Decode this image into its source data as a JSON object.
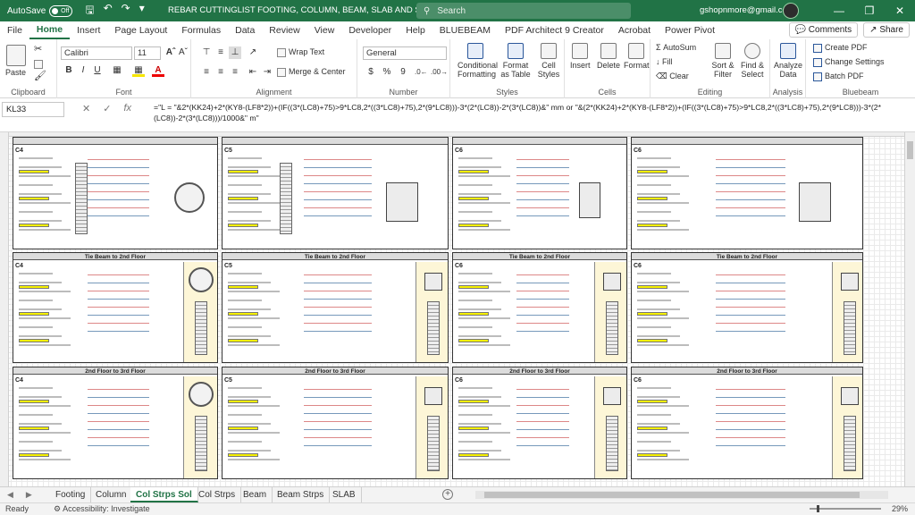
{
  "titlebar": {
    "autosave_label": "AutoSave",
    "autosave_state": "Off",
    "doc_title": "REBAR CUTTINGLIST FOOTING, COLUMN, BEAM, SLAB AND STIRRUPS",
    "search_placeholder": "Search",
    "user_email": "gshopnmore@gmail.com"
  },
  "menu": {
    "tabs": [
      "File",
      "Home",
      "Insert",
      "Page Layout",
      "Formulas",
      "Data",
      "Review",
      "View",
      "Developer",
      "Help",
      "BLUEBEAM",
      "PDF Architect 9 Creator",
      "Acrobat",
      "Power Pivot"
    ],
    "comments": "Comments",
    "share": "Share"
  },
  "ribbon": {
    "clipboard": {
      "label": "Clipboard",
      "paste": "Paste"
    },
    "font": {
      "label": "Font",
      "name": "Calibri",
      "size": "11",
      "bold": "B",
      "italic": "I",
      "underline": "U"
    },
    "alignment": {
      "label": "Alignment",
      "wrap": "Wrap Text",
      "merge": "Merge & Center"
    },
    "number": {
      "label": "Number",
      "format": "General",
      "currency": "$",
      "percent": "%",
      "comma": "9"
    },
    "styles": {
      "label": "Styles",
      "conditional": "Conditional Formatting",
      "format_table": "Format as Table",
      "cell_styles": "Cell Styles"
    },
    "cells": {
      "label": "Cells",
      "insert": "Insert",
      "delete": "Delete",
      "format": "Format"
    },
    "editing": {
      "label": "Editing",
      "autosum": "AutoSum",
      "fill": "Fill",
      "clear": "Clear",
      "sort": "Sort & Filter",
      "find": "Find & Select"
    },
    "analysis": {
      "label": "Analysis",
      "analyze": "Analyze Data"
    },
    "bluebeam": {
      "label": "Bluebeam",
      "create_pdf": "Create PDF",
      "change_settings": "Change Settings",
      "batch_pdf": "Batch PDF"
    }
  },
  "formula_bar": {
    "cell_ref": "KL33",
    "fx": "fx",
    "formula": "=\"L = \"&2*(KK24)+2*(KY8-(LF8*2))+(IF((3*(LC8)+75)>9*LC8,2*((3*LC8)+75),2*(9*LC8)))-3*(2*(LC8))-2*(3*(LC8))&\" mm or \"&(2*(KK24)+2*(KY8-(LF8*2))+(IF((3*(LC8)+75)>9*LC8,2*((3*LC8)+75),2*(9*LC8)))-3*(2*(LC8))-2*(3*(LC8)))/1000&\" m\""
  },
  "sheet": {
    "row_labels": [
      "C4",
      "C5",
      "C6"
    ],
    "sections": [
      "Tie Beam to 2nd Floor",
      "2nd Floor to 3rd Floor"
    ]
  },
  "sheet_tabs": {
    "tabs": [
      "Footing",
      "Column",
      "Col Strps Sol",
      "Col Strps",
      "Beam",
      "Beam Strps",
      "SLAB"
    ],
    "active": "Col Strps Sol"
  },
  "status": {
    "ready": "Ready",
    "accessibility": "Accessibility: Investigate",
    "zoom": "29%"
  }
}
